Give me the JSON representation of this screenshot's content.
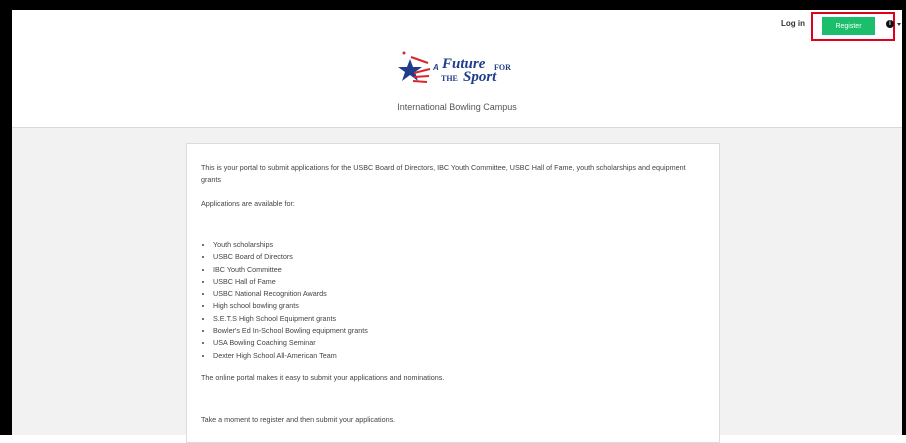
{
  "nav": {
    "login_label": "Log in",
    "register_label": "Register",
    "info_icon": "info-icon",
    "caret_icon": "chevron-down-icon"
  },
  "logo": {
    "a": "A",
    "future": "Future",
    "for": "FOR",
    "the": "THE",
    "sport": "Sport"
  },
  "site_subtitle": "International Bowling Campus",
  "content": {
    "intro": "This is your portal to submit applications for the USBC Board of Directors, IBC Youth Committee, USBC Hall of Fame, youth scholarships and equipment grants",
    "available_heading": "Applications are available for:",
    "applications": [
      "Youth scholarships",
      "USBC Board of Directors",
      "IBC Youth Committee",
      "USBC Hall of Fame",
      "USBC National Recognition Awards",
      "High school bowling grants",
      "S.E.T.S High School Equipment grants",
      "Bowler's Ed In-School Bowling equipment grants",
      "USA Bowling Coaching Seminar",
      "Dexter High School All-American Team"
    ],
    "ease_text": "The online portal makes it easy to submit your applications and nominations.",
    "moment_text": "Take a moment to register and then submit your applications."
  },
  "colors": {
    "register_green": "#1bbf6b",
    "highlight_red": "#e0001b",
    "logo_blue": "#1f3d8a",
    "logo_red": "#d7282f"
  }
}
